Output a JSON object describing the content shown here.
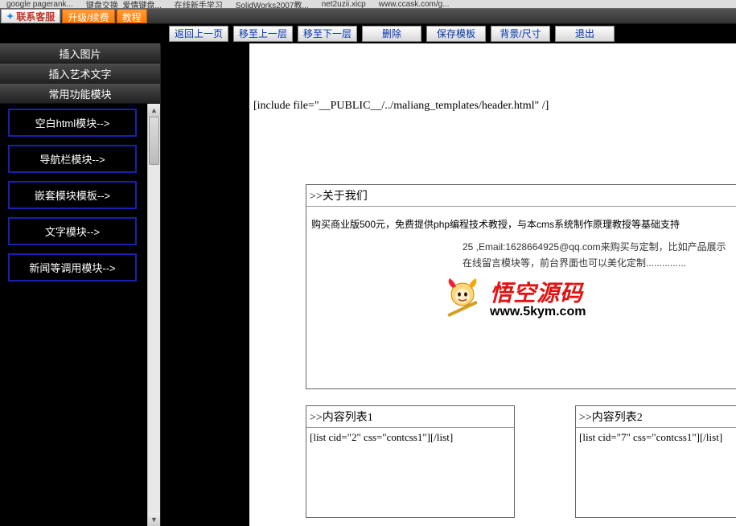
{
  "browser_tabs": [
    "google pagerank...",
    "键盘交换_爱情键盘...",
    "在线新手学习",
    "SolidWorks2007教...",
    "net2uzii.xicp",
    "www.ccask.com/g..."
  ],
  "topbar": {
    "contact": "联系客服",
    "upgrade": "升级/续费",
    "tutorial": "教程"
  },
  "actions": {
    "back": "返回上一页",
    "move_prev": "移至上一层",
    "move_next": "移至下一层",
    "delete": "删除",
    "save_tpl": "保存模板",
    "bg_size": "背景/尺寸",
    "exit": "退出"
  },
  "sidebar": {
    "insert_image": "插入图片",
    "insert_art_text": "插入艺术文字",
    "common_modules": "常用功能模块",
    "modules": [
      "空白html模块-->",
      "导航栏模块-->",
      "嵌套模块模板-->",
      "文字模块-->",
      "新闻等调用模块-->"
    ]
  },
  "canvas": {
    "include_line": "[include file=\"__PUBLIC__/../maliang_templates/header.html\" /]",
    "about": {
      "title": ">>关于我们",
      "p1": "购买商业版500元，免费提供php编程技术教授，与本cms系统制作原理教授等基础支持",
      "p2": "25 ,Email:1628664925@qq.com来购买与定制，比如产品展示在线留言模块等，前台界面也可以美化定制..............."
    },
    "list1": {
      "title": ">>内容列表1",
      "code": "[list cid=\"2\" css=\"contcss1\"][/list]"
    },
    "list2": {
      "title": ">>内容列表2",
      "code": "[list cid=\"7\" css=\"contcss1\"][/list]"
    }
  },
  "watermark": {
    "cn": "悟空源码",
    "url": "www.5kym.com"
  }
}
